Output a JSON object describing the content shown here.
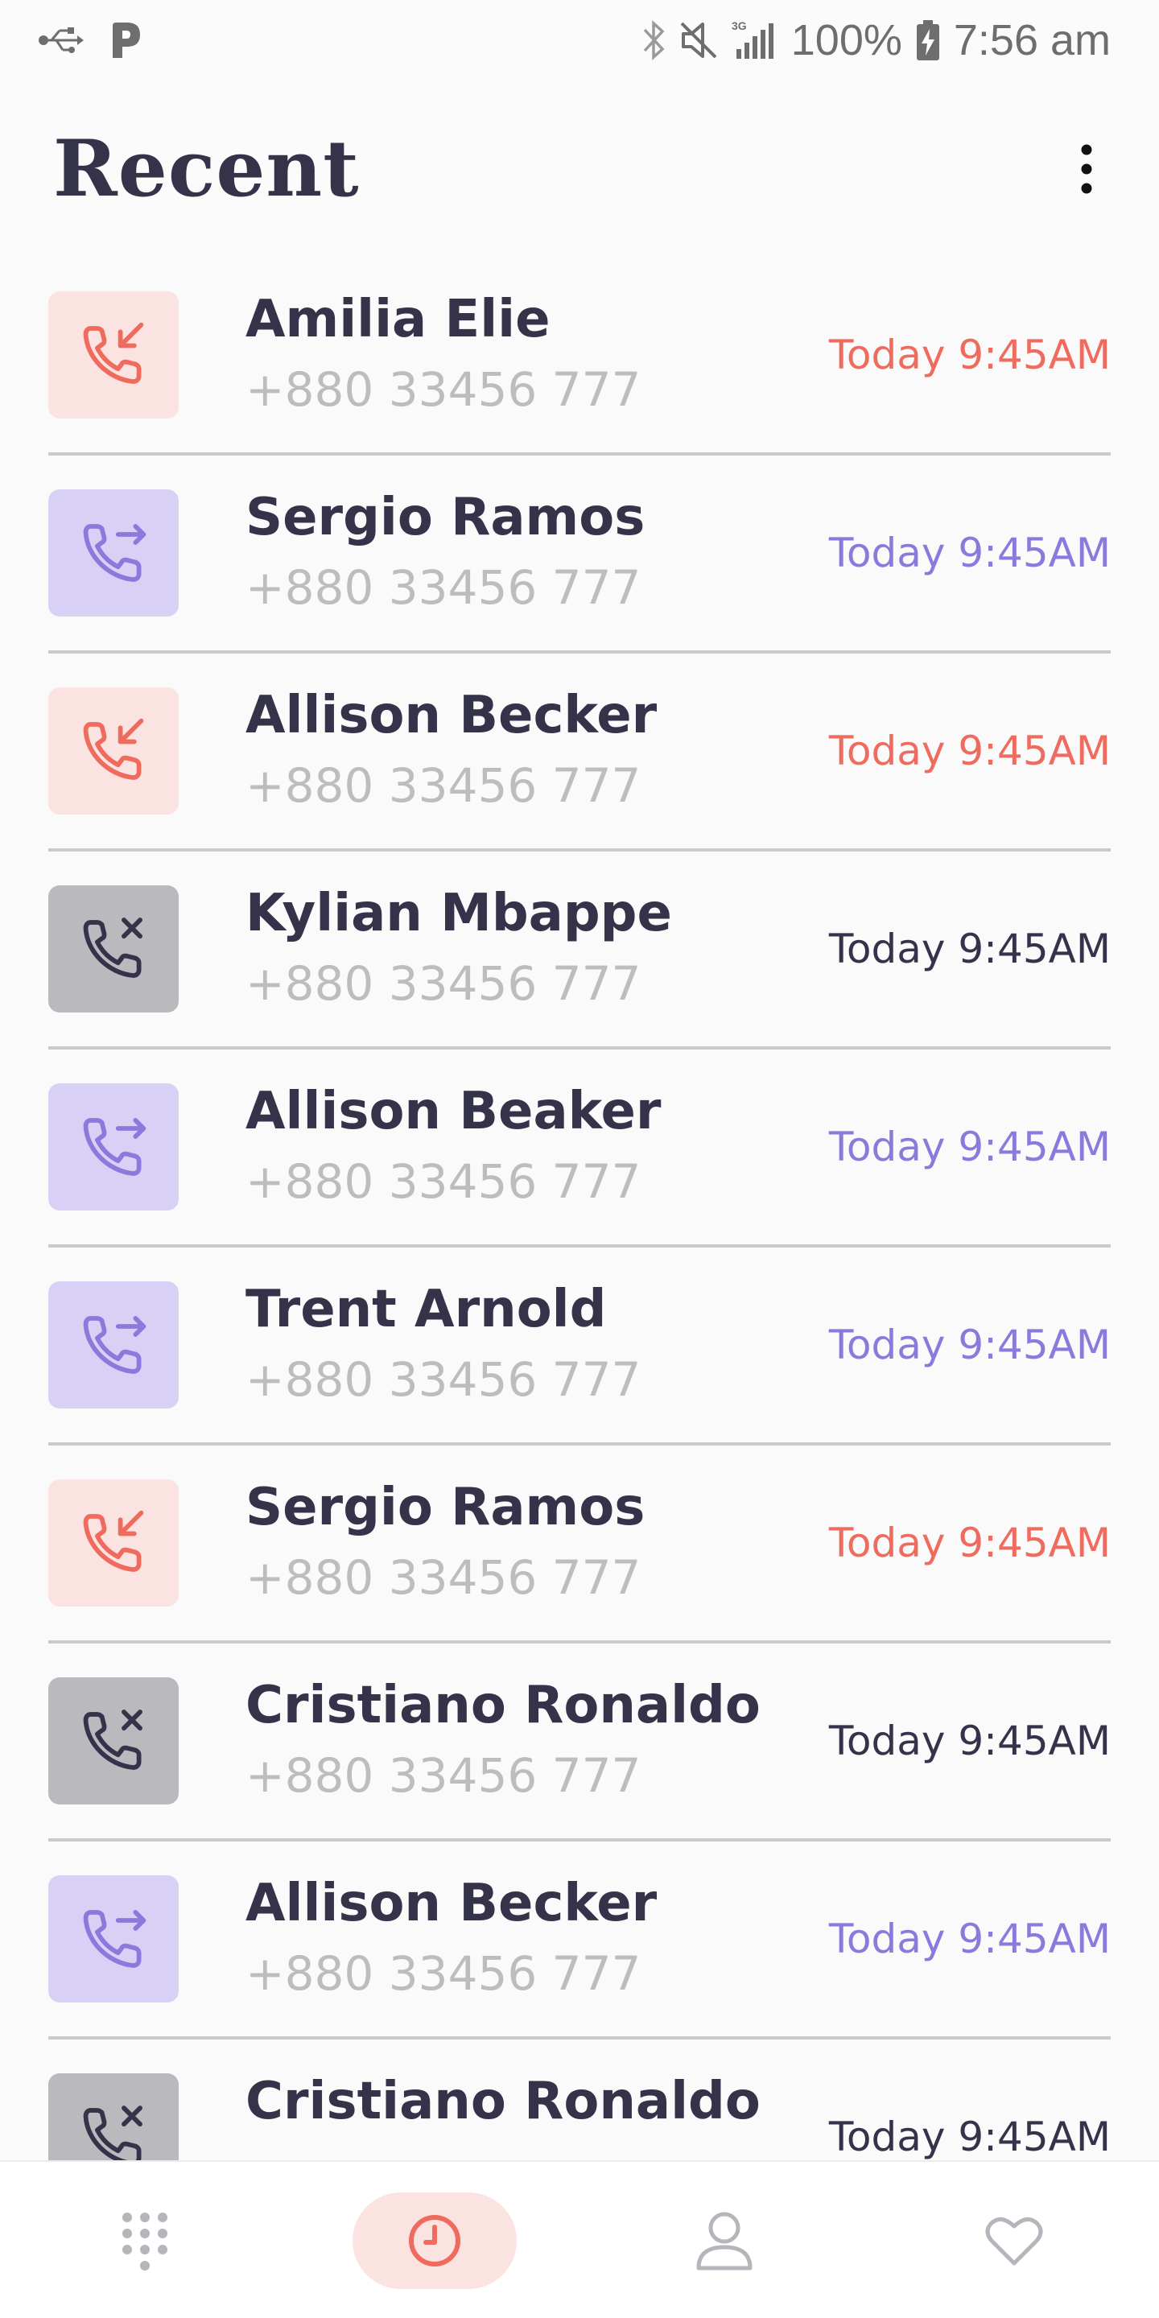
{
  "status_bar": {
    "battery": "100%",
    "time": "7:56 am",
    "network": "3G"
  },
  "header": {
    "title": "Recent"
  },
  "colors": {
    "incoming": "#ef6b5e",
    "outgoing": "#8c79dc",
    "missed": "#343349",
    "incoming_bg": "#fbe3e1",
    "outgoing_bg": "#d8d1f5",
    "missed_bg": "#b9b9be"
  },
  "calls": [
    {
      "name": "Amilia Elie",
      "number": "+880 33456 777",
      "time": "Today 9:45AM",
      "type": "incoming",
      "icon": "incoming-call-icon"
    },
    {
      "name": "Sergio Ramos",
      "number": "+880 33456 777",
      "time": "Today 9:45AM",
      "type": "outgoing",
      "icon": "outgoing-call-icon"
    },
    {
      "name": "Allison Becker",
      "number": "+880 33456 777",
      "time": "Today 9:45AM",
      "type": "incoming",
      "icon": "incoming-call-icon"
    },
    {
      "name": "Kylian Mbappe",
      "number": "+880 33456 777",
      "time": "Today 9:45AM",
      "type": "missed",
      "icon": "missed-call-icon"
    },
    {
      "name": "Allison Beaker",
      "number": "+880 33456 777",
      "time": "Today 9:45AM",
      "type": "outgoing",
      "icon": "outgoing-call-icon"
    },
    {
      "name": "Trent Arnold",
      "number": "+880 33456 777",
      "time": "Today 9:45AM",
      "type": "outgoing",
      "icon": "outgoing-call-icon"
    },
    {
      "name": "Sergio Ramos",
      "number": "+880 33456 777",
      "time": "Today 9:45AM",
      "type": "incoming",
      "icon": "incoming-call-icon"
    },
    {
      "name": "Cristiano Ronaldo",
      "number": "+880 33456 777",
      "time": "Today 9:45AM",
      "type": "missed",
      "icon": "missed-call-icon"
    },
    {
      "name": "Allison Becker",
      "number": "+880 33456 777",
      "time": "Today 9:45AM",
      "type": "outgoing",
      "icon": "outgoing-call-icon"
    },
    {
      "name": "Cristiano Ronaldo",
      "number": "",
      "time": "Today 9:45AM",
      "type": "missed",
      "icon": "missed-call-icon"
    }
  ],
  "bottom_nav": {
    "items": [
      {
        "icon": "dialpad-icon",
        "active": false
      },
      {
        "icon": "clock-icon",
        "active": true
      },
      {
        "icon": "person-icon",
        "active": false
      },
      {
        "icon": "heart-icon",
        "active": false
      }
    ]
  }
}
